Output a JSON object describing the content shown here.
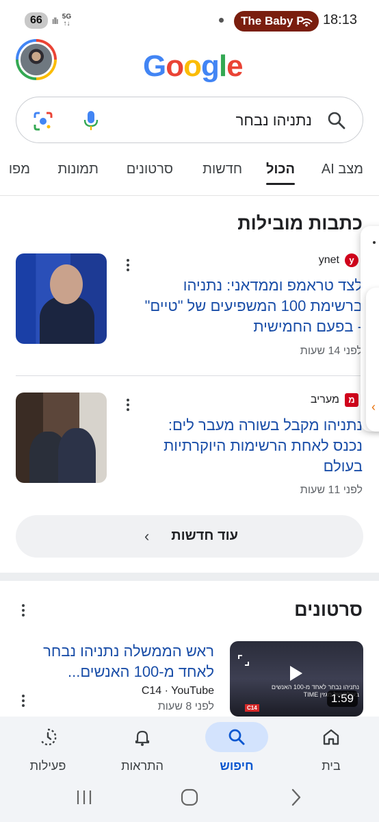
{
  "status_bar": {
    "battery": "66",
    "network": "5G",
    "media_pill": "The Baby P",
    "time": "18:13"
  },
  "header": {
    "logo": "Google",
    "logo_colors": [
      "#4285f4",
      "#ea4335",
      "#fbbc05",
      "#4285f4",
      "#34a853",
      "#ea4335"
    ]
  },
  "search": {
    "query": "נתניהו נבחר"
  },
  "tabs": [
    {
      "label": "מצב AI"
    },
    {
      "label": "הכול",
      "active": true
    },
    {
      "label": "חדשות"
    },
    {
      "label": "סרטונים"
    },
    {
      "label": "תמונות"
    },
    {
      "label": "מפו"
    }
  ],
  "top_stories": {
    "title": "כתבות מובילות",
    "articles": [
      {
        "source": "ynet",
        "source_logo": "y",
        "headline": "לצד טראמפ וממדאני: נתניהו\nברשימת 100 המשפיעים של \"טיים\"\n- בפעם החמישית",
        "time": "לפני 14 שעות"
      },
      {
        "source": "מעריב",
        "source_logo": "מ",
        "headline": "נתניהו מקבל בשורה מעבר לים:\nנכנס לאחת הרשימות היוקרתיות\nבעולם",
        "time": "לפני 11 שעות"
      }
    ],
    "more_label": "עוד חדשות"
  },
  "videos": {
    "title": "סרטונים",
    "items": [
      {
        "title": "ראש הממשלה נתניהו נבחר\nלאחד מ-100 האנשים...",
        "source": "C14 · YouTube",
        "time": "לפני 8 שעות",
        "duration": "1:59",
        "thumb_caption": "נתניהו נבחר לאחד מ-100 האנשים בעולם של מגזין TIME",
        "thumb_logo": "C14"
      }
    ]
  },
  "bottom_nav": [
    {
      "label": "בית",
      "icon": "home-icon"
    },
    {
      "label": "חיפוש",
      "icon": "search-icon",
      "active": true
    },
    {
      "label": "התראות",
      "icon": "bell-icon"
    },
    {
      "label": "פעילות",
      "icon": "activity-icon"
    }
  ],
  "accent_color": "#0b57d0",
  "link_color": "#1a4ea8"
}
